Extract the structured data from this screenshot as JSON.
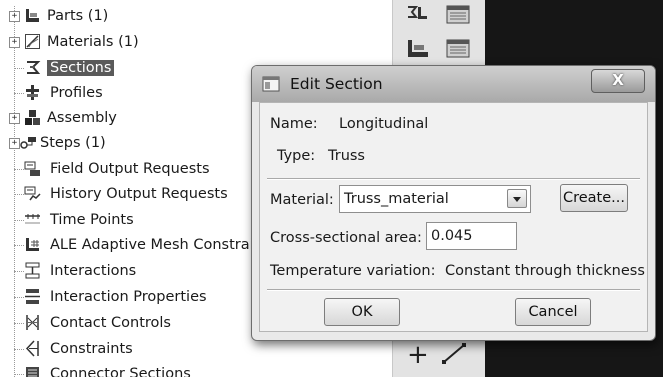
{
  "tree": {
    "items": [
      {
        "label": "Parts (1)",
        "icon": "parts-icon",
        "expander": "+"
      },
      {
        "label": "Materials (1)",
        "icon": "materials-icon",
        "expander": "+"
      },
      {
        "label": "Sections",
        "icon": "sections-icon",
        "selected": true
      },
      {
        "label": "Profiles",
        "icon": "profiles-icon"
      },
      {
        "label": "Assembly",
        "icon": "assembly-icon",
        "expander": "+"
      },
      {
        "label": "Steps (1)",
        "icon": "steps-icon",
        "expander": "+"
      },
      {
        "label": "Field Output Requests",
        "icon": "field-output-icon"
      },
      {
        "label": "History Output Requests",
        "icon": "history-output-icon"
      },
      {
        "label": "Time Points",
        "icon": "time-points-icon"
      },
      {
        "label": "ALE Adaptive Mesh Constraints",
        "icon": "ale-mesh-icon"
      },
      {
        "label": "Interactions",
        "icon": "interactions-icon"
      },
      {
        "label": "Interaction Properties",
        "icon": "interaction-properties-icon"
      },
      {
        "label": "Contact Controls",
        "icon": "contact-controls-icon"
      },
      {
        "label": "Constraints",
        "icon": "constraints-icon"
      },
      {
        "label": "Connector Sections",
        "icon": "connector-sections-icon"
      }
    ]
  },
  "toolbox": {
    "plus_glyph": "+",
    "icons": [
      "create-section-icon",
      "section-manager-icon",
      "assign-section-icon",
      "assignment-manager-icon",
      "create-point-icon",
      "line-tool-icon"
    ]
  },
  "dialog": {
    "title": "Edit Section",
    "close_label": "X",
    "name_label": "Name:",
    "name_value": "Longitudinal",
    "type_label": "Type:",
    "type_value": "Truss",
    "material_label": "Material:",
    "material_value": "Truss_material",
    "create_label": "Create...",
    "area_label": "Cross-sectional area:",
    "area_value": "0.045",
    "temp_label": "Temperature variation:",
    "temp_value": "Constant through thickness",
    "ok_label": "OK",
    "cancel_label": "Cancel"
  }
}
